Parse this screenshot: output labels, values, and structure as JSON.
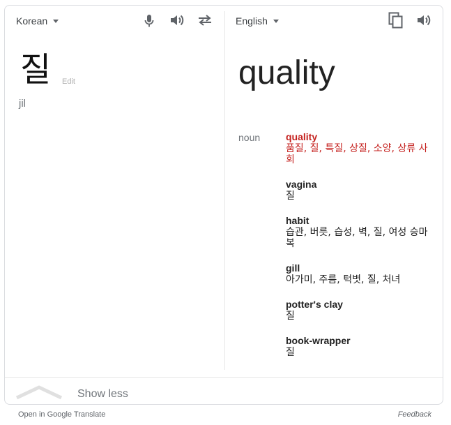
{
  "source": {
    "language": "Korean",
    "word": "질",
    "edit_label": "Edit",
    "transliteration": "jil"
  },
  "target": {
    "language": "English",
    "word": "quality"
  },
  "dictionary": {
    "part_of_speech": "noun",
    "entries": [
      {
        "word": "quality",
        "translations": "품질, 질, 특질, 상질, 소양, 상류 사회",
        "highlighted": true
      },
      {
        "word": "vagina",
        "translations": "질",
        "highlighted": false
      },
      {
        "word": "habit",
        "translations": "습관, 버릇, 습성, 벽, 질, 여성 승마복",
        "highlighted": false
      },
      {
        "word": "gill",
        "translations": "아가미, 주름, 턱볏, 질, 처녀",
        "highlighted": false
      },
      {
        "word": "potter's clay",
        "translations": "질",
        "highlighted": false
      },
      {
        "word": "book-wrapper",
        "translations": "질",
        "highlighted": false
      }
    ]
  },
  "controls": {
    "show_less_label": "Show less",
    "open_label": "Open in Google Translate",
    "feedback_label": "Feedback"
  },
  "icons": {
    "mic": "microphone-icon",
    "source_speaker": "speaker-icon",
    "swap": "swap-languages-icon",
    "copy": "copy-icon",
    "target_speaker": "speaker-icon",
    "show_less": "chevron-up-icon"
  },
  "colors": {
    "highlight": "#c5221f",
    "icon": "#5f6368",
    "border": "#dadce0"
  }
}
